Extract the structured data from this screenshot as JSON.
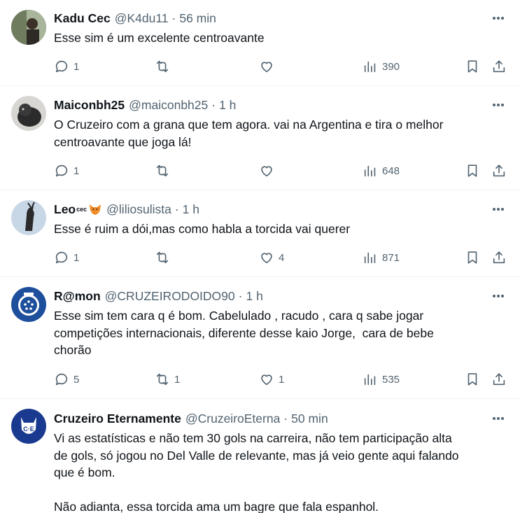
{
  "tweets": [
    {
      "name": "Kadu Cec",
      "name_sup": "",
      "handle": "@K4du11",
      "separator": "·",
      "time": "56 min",
      "text": "Esse sim é um excelente centroavante",
      "replies": "1",
      "retweets": "",
      "likes": "",
      "views": "390"
    },
    {
      "name": "Maiconbh25",
      "name_sup": "",
      "handle": "@maiconbh25",
      "separator": "·",
      "time": "1 h",
      "text": "O Cruzeiro com a grana que tem agora. vai na Argentina e tira o melhor\ncentroavante que joga lá!",
      "replies": "1",
      "retweets": "",
      "likes": "",
      "views": "648"
    },
    {
      "name": "Leo",
      "name_sup": "cec",
      "handle": "@liliosulista",
      "separator": "·",
      "time": "1 h",
      "text": "Esse é ruim a dói,mas como habla a torcida vai querer",
      "replies": "1",
      "retweets": "",
      "likes": "4",
      "views": "871"
    },
    {
      "name": "R@mon",
      "name_sup": "",
      "handle": "@CRUZEIRODOIDO90",
      "separator": "·",
      "time": "1 h",
      "text": "Esse sim tem cara q é bom. Cabelulado , racudo , cara q sabe jogar\ncompetições internacionais, diferente desse kaio Jorge,  cara de bebe\nchorão",
      "replies": "5",
      "retweets": "1",
      "likes": "1",
      "views": "535"
    },
    {
      "name": "Cruzeiro Eternamente",
      "name_sup": "",
      "handle": "@CruzeiroEterna",
      "separator": "·",
      "time": "50 min",
      "text": "Vi as estatísticas e não tem 30 gols na carreira, não tem participação alta\nde gols, só jogou no Del Valle de relevante, mas já veio gente aqui falando\nque é bom.\n\nNão adianta, essa torcida ama um bagre que fala espanhol.",
      "replies": "",
      "retweets": "",
      "likes": "",
      "views": ""
    }
  ],
  "colors": {
    "text_primary": "#0f1419",
    "text_secondary": "#536471",
    "divider": "#eff3f4"
  },
  "icons": [
    "reply-icon",
    "retweet-icon",
    "like-icon",
    "views-icon",
    "bookmark-icon",
    "share-icon",
    "more-icon"
  ]
}
